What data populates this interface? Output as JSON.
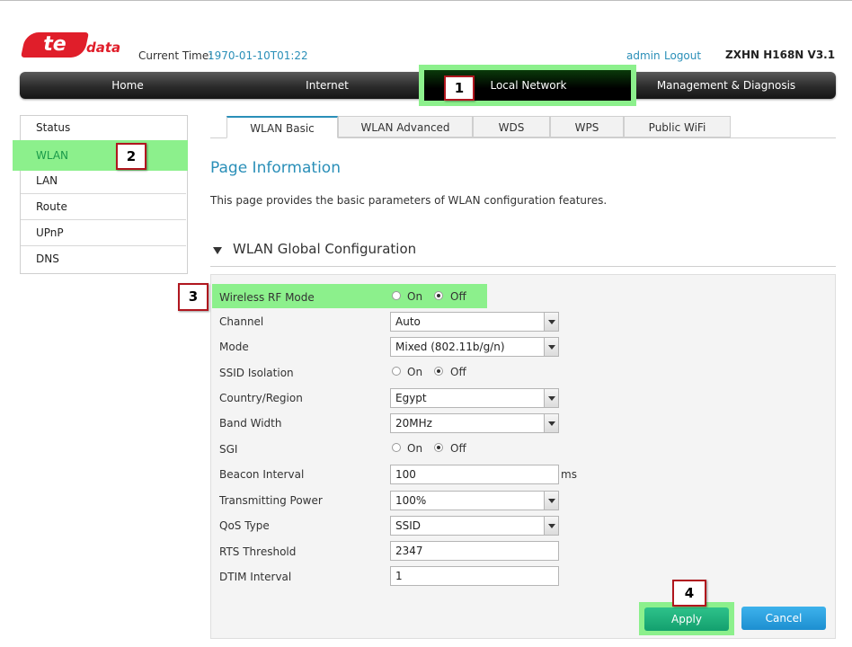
{
  "header": {
    "logo_te": "te",
    "logo_data": "data",
    "current_time_label": "Current Time:",
    "current_time_value": "1970-01-10T01:22",
    "admin": "admin",
    "logout": "Logout",
    "model": "ZXHN H168N V3.1"
  },
  "nav": {
    "home": "Home",
    "internet": "Internet",
    "local_network": "Local Network",
    "management": "Management & Diagnosis"
  },
  "callouts": [
    "1",
    "2",
    "3",
    "4"
  ],
  "sidebar": {
    "items": [
      {
        "label": "Status"
      },
      {
        "label": "WLAN"
      },
      {
        "label": "LAN"
      },
      {
        "label": "Route"
      },
      {
        "label": "UPnP"
      },
      {
        "label": "DNS"
      }
    ]
  },
  "tabs": [
    {
      "label": "WLAN Basic"
    },
    {
      "label": "WLAN Advanced"
    },
    {
      "label": "WDS"
    },
    {
      "label": "WPS"
    },
    {
      "label": "Public WiFi"
    }
  ],
  "page": {
    "title": "Page Information",
    "description": "This page provides the basic parameters of WLAN configuration features.",
    "section_title": "WLAN Global Configuration"
  },
  "form": {
    "rf_mode": {
      "label": "Wireless RF Mode",
      "on": "On",
      "off": "Off",
      "selected": "Off"
    },
    "channel": {
      "label": "Channel",
      "value": "Auto"
    },
    "mode": {
      "label": "Mode",
      "value": "Mixed (802.11b/g/n)"
    },
    "ssid_isolation": {
      "label": "SSID Isolation",
      "on": "On",
      "off": "Off",
      "selected": "Off"
    },
    "country": {
      "label": "Country/Region",
      "value": "Egypt"
    },
    "bandwidth": {
      "label": "Band Width",
      "value": "20MHz"
    },
    "sgi": {
      "label": "SGI",
      "on": "On",
      "off": "Off",
      "selected": "Off"
    },
    "beacon": {
      "label": "Beacon Interval",
      "value": "100",
      "unit": "ms"
    },
    "tx_power": {
      "label": "Transmitting Power",
      "value": "100%"
    },
    "qos": {
      "label": "QoS Type",
      "value": "SSID"
    },
    "rts": {
      "label": "RTS Threshold",
      "value": "2347"
    },
    "dtim": {
      "label": "DTIM Interval",
      "value": "1"
    }
  },
  "buttons": {
    "apply": "Apply",
    "cancel": "Cancel"
  },
  "colors": {
    "link": "#2a8fb8",
    "highlight": "#8cf08c",
    "brand_red": "#e01e2a",
    "apply": "#13a06e",
    "cancel": "#1d8fd0"
  }
}
